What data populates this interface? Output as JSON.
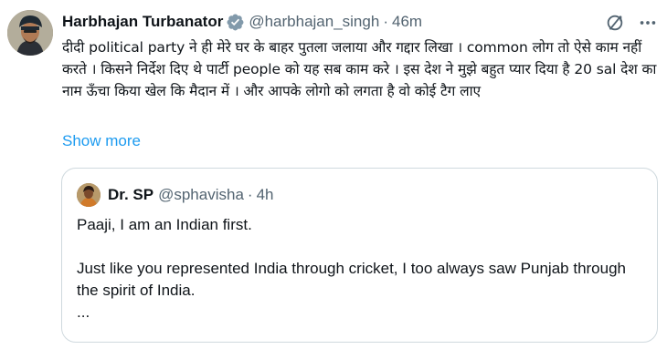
{
  "tweet": {
    "author_name": "Harbhajan Turbanator",
    "verified_icon": "verified-badge-icon",
    "handle": "@harbhajan_singh",
    "separator": "·",
    "time": "46m",
    "text": "दीदी political party ने ही मेरे घर के बाहर पुतला जलाया और गद्दार लिखा । common लोग तो ऐसे काम नहीं करते । किसने निर्देश दिए थे पार्टी people को यह सब काम करे । इस देश ने मुझे बहुत प्यार दिया है 20 sal देश का नाम ऊँचा किया खेल कि मैदान में । और आपके लोगो को लगता है वो कोई टैग लाए",
    "show_more": "Show more",
    "icons": [
      "grok-icon",
      "more-icon"
    ]
  },
  "quote": {
    "author_name": "Dr. SP",
    "handle": "@sphavisha",
    "separator": "·",
    "time": "4h",
    "line1": "Paaji, I am an Indian first.",
    "line2": "Just like you represented India through cricket, I too always saw Punjab through the spirit of India.",
    "line3": "..."
  },
  "colors": {
    "text": "#0f1419",
    "secondary": "#536471",
    "link": "#1d9bf0",
    "border": "#cfd9de",
    "verified": "#829aab"
  }
}
